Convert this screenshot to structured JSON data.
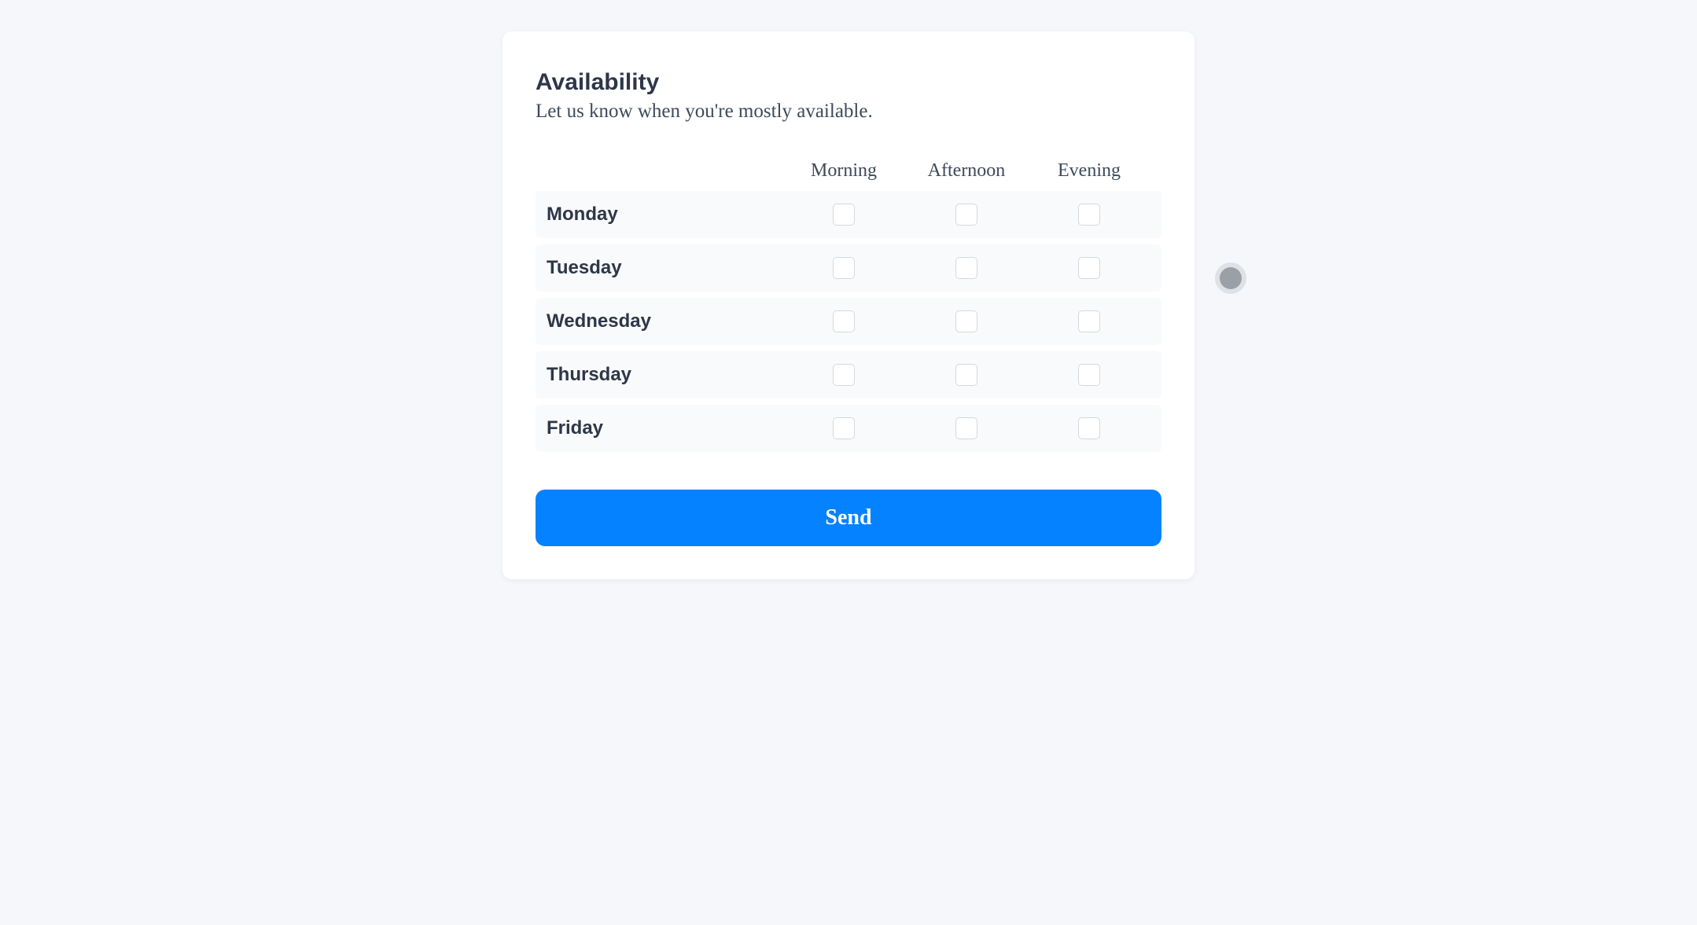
{
  "heading": "Availability",
  "subheading": "Let us know when you're mostly available.",
  "columns": [
    "Morning",
    "Afternoon",
    "Evening"
  ],
  "rows": [
    "Monday",
    "Tuesday",
    "Wednesday",
    "Thursday",
    "Friday"
  ],
  "submit_label": "Send"
}
